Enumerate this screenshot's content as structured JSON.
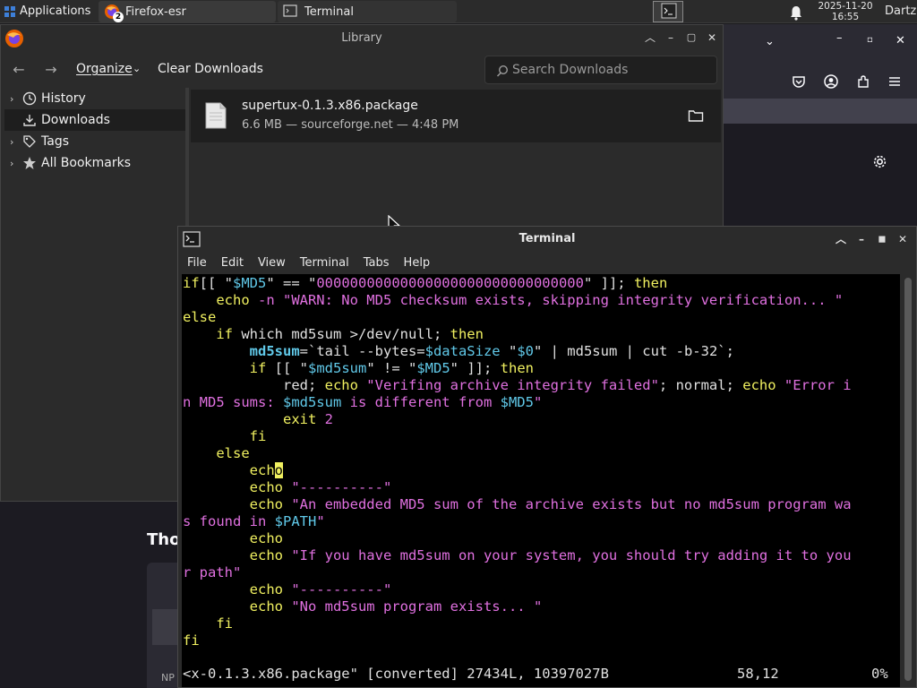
{
  "panel": {
    "applications_label": "Applications",
    "tasks": [
      {
        "label": "Firefox-esr",
        "badge": "2"
      },
      {
        "label": "Terminal"
      }
    ],
    "clock_date": "2025-11-20",
    "clock_time": "16:55",
    "user": "Dartz"
  },
  "library": {
    "title": "Library",
    "toolbar": {
      "organize": "Organize",
      "clear_downloads": "Clear Downloads",
      "search_placeholder": "Search Downloads"
    },
    "sidebar": [
      {
        "label": "History",
        "icon": "clock-icon",
        "expandable": true
      },
      {
        "label": "Downloads",
        "icon": "download-icon",
        "expandable": false,
        "selected": true
      },
      {
        "label": "Tags",
        "icon": "tag-icon",
        "expandable": true
      },
      {
        "label": "All Bookmarks",
        "icon": "star-icon",
        "expandable": true
      }
    ],
    "download": {
      "filename": "supertux-0.1.3.x86.package",
      "meta": "6.6 MB — sourceforge.net — 4:48 PM"
    }
  },
  "firefox_bg": {
    "page_heading": "Tho",
    "card_text": "NP"
  },
  "terminal": {
    "title": "Terminal",
    "menu": [
      "File",
      "Edit",
      "View",
      "Terminal",
      "Tabs",
      "Help"
    ],
    "status_file": "<x-0.1.3.x86.package\" [converted] 27434L, 10397027B",
    "status_pos": "58,12",
    "status_pct": "0%"
  }
}
